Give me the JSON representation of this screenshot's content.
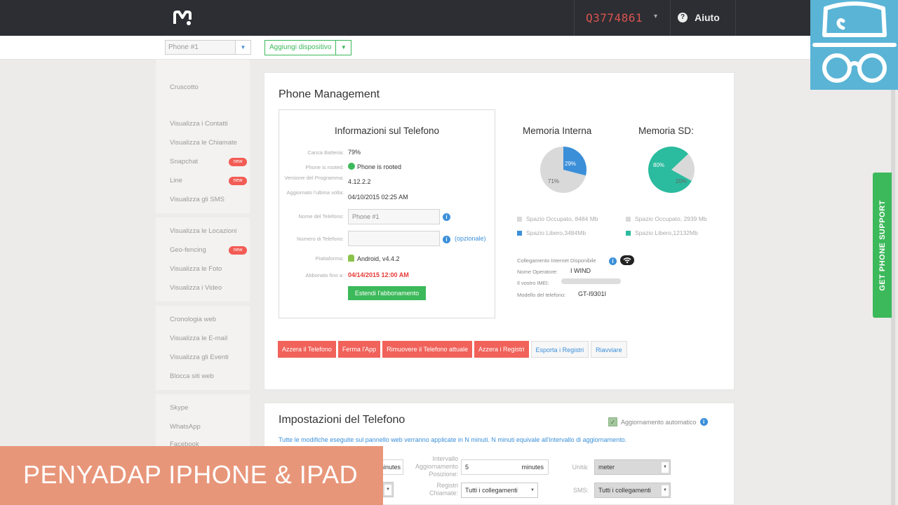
{
  "header": {
    "account_id": "Q3774861",
    "account_caret": "▾",
    "help_icon": "?",
    "help_label": "Aiuto"
  },
  "subbar": {
    "phone_select_value": "Phone #1",
    "dropdown_icon": "▼",
    "add_device_label": "Aggiungi dispositivo"
  },
  "sidebar": {
    "items": [
      {
        "label": "Cruscotto"
      },
      {
        "label": "Visualizza i Contatti"
      },
      {
        "label": "Visualizza le Chiamate"
      },
      {
        "label": "Snapchat",
        "badge": "new"
      },
      {
        "label": "Line",
        "badge": "new"
      },
      {
        "label": "Visualizza gli SMS"
      },
      {
        "label": "Visualizza le Locazioni"
      },
      {
        "label": "Geo-fencing",
        "badge": "new"
      },
      {
        "label": "Visualizza le Foto"
      },
      {
        "label": "Visualizza i Video"
      },
      {
        "label": "Cronologia web"
      },
      {
        "label": "Visualizza le E-mail"
      },
      {
        "label": "Visualizza gli Eventi"
      },
      {
        "label": "Blocca siti web"
      },
      {
        "label": "Skype"
      },
      {
        "label": "WhatsApp"
      },
      {
        "label": "Facebook monitoraggio"
      }
    ]
  },
  "management": {
    "title": "Phone Management",
    "info": {
      "title": "Informazioni sul Telefono",
      "battery_label": "Carica Batteria:",
      "battery_value": "79%",
      "rooted_label": "Phone is rooted:",
      "rooted_value": "Phone is rooted",
      "version_label": "Versione del Programma:",
      "version_value": "4.12.2.2",
      "updated_label": "Aggiornato l'ultima volta:",
      "updated_value": "04/10/2015 02:25 AM",
      "name_label": "Nome del Telefono:",
      "name_value": "Phone #1",
      "number_label": "Numero di Telefono:",
      "number_value": "",
      "optional_link": "(opzionale)",
      "info_icon": "i",
      "platform_label": "Piattaforma:",
      "platform_value": "Android, v4.4.2",
      "subscribed_label": "Abbonato fino a:",
      "subscribed_value": "04/14/2015 12:00 AM",
      "extend_button": "Estendi l'abbonamento"
    },
    "memory": {
      "internal_title": "Memoria Interna",
      "sd_title": "Memoria SD:",
      "internal_used_pct_label": "71%",
      "internal_free_pct_label": "29%",
      "internal_used_legend": "Spazio Occupato, 8484 Mb",
      "internal_free_legend": "Spazio Libero,3484Mb",
      "sd_used_pct_label": "20%",
      "sd_free_pct_label": "80%",
      "sd_used_legend": "Spazio Occupato, 2939 Mb",
      "sd_free_legend": "Spazio Libero,12132Mb",
      "internal_used_fraction": 0.71,
      "sd_used_fraction": 0.2,
      "colors": {
        "used": "#d9d9d9",
        "internal_free": "#3b8fd9",
        "sd_free": "#2bbb9e"
      }
    },
    "network": {
      "connection_label": "Collegamento Internet Disponibile",
      "operator_label": "Nome Operatore:",
      "operator_value": "I WIND",
      "imei_label": "Il vostro IMEI:",
      "model_label": "Modello del telefono:",
      "model_value": "GT-I9301I"
    },
    "actions": [
      {
        "label": "Azzera il Telefono",
        "style": "red"
      },
      {
        "label": "Ferma l'App",
        "style": "red"
      },
      {
        "label": "Rimuovere il Telefono attuale",
        "style": "red"
      },
      {
        "label": "Azzera i Registri",
        "style": "red"
      },
      {
        "label": "Esporta i Registri",
        "style": "white"
      },
      {
        "label": "Riavviare",
        "style": "white"
      }
    ]
  },
  "settings": {
    "title": "Impostazioni del Telefono",
    "auto_update_label": "Aggiornamento automatico",
    "check_mark": "✓",
    "note": "Tutte le modifiche eseguite sul pannello web verranno applicate in N minuti. N minuti equivale all'intervallo di aggiornamento.",
    "first_unit": "minutes",
    "position_interval_label": "Intervallo Aggiornamento Posizione:",
    "position_interval_value": "5",
    "position_interval_unit": "minutes",
    "units_label": "Unità:",
    "units_value": "meter",
    "calls_label": "Registri Chiamate:",
    "calls_value": "Tutti i collegamenti",
    "sms_label": "SMS:",
    "sms_value": "Tutti i collegamenti",
    "select_arrow": "▼"
  },
  "support_tab": {
    "label": "GET PHONE SUPPORT"
  },
  "banner": {
    "text": "PENYADAP IPHONE & IPAD"
  }
}
